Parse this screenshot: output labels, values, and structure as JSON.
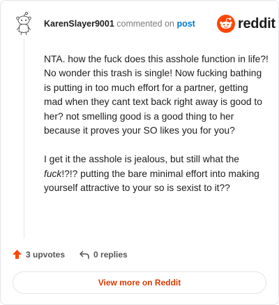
{
  "header": {
    "username": "KarenSlayer9001",
    "action_text": "commented on",
    "link_text": "post"
  },
  "brand": {
    "wordmark": "reddit",
    "color": "#ff4500"
  },
  "comment": {
    "paragraph_1": "NTA. how the fuck does this asshole function in life?! No wonder this trash is single! Now fucking bathing is putting in too much effort for a partner, getting mad when they cant text back right away is good to her? not smelling good is a good thing to her because it proves your SO likes you for you?",
    "paragraph_2_before": "I get it the asshole is jealous, but still what the ",
    "paragraph_2_em": "fuck",
    "paragraph_2_after": "!?!? putting the bare minimal effort into making yourself attractive to your so is sexist to it??"
  },
  "actions": {
    "upvotes_label": "3 upvotes",
    "replies_label": "0 replies",
    "upvote_color": "#ff4500"
  },
  "view_more_label": "View more on Reddit",
  "view_more_color": "#d93a00",
  "link_color": "#0079d3"
}
